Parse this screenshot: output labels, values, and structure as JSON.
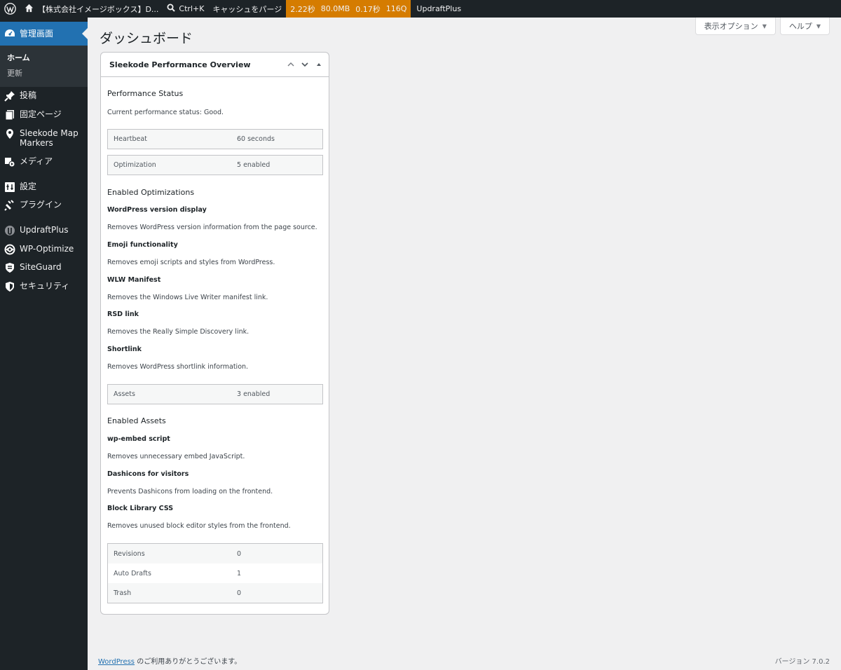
{
  "adminbar": {
    "site_name": "【株式会社イメージボックス】D...",
    "search_shortcut": "Ctrl+K",
    "purge_cache": "キャッシュをパージ",
    "perf": {
      "time": "2.22秒",
      "memory": "80.0MB",
      "query_time": "0.17秒",
      "queries": "116Q"
    },
    "updraft": "UpdraftPlus"
  },
  "sidebar": {
    "dashboard": "管理画面",
    "submenu": [
      "ホーム",
      "更新"
    ],
    "items": [
      {
        "label": "投稿",
        "icon": "pushpin-icon"
      },
      {
        "label": "固定ページ",
        "icon": "pages-icon"
      },
      {
        "label": "Sleekode Map Markers",
        "icon": "location-pin-icon"
      },
      {
        "label": "メディア",
        "icon": "media-icon"
      },
      {
        "label": "設定",
        "icon": "settings-icon"
      },
      {
        "label": "プラグイン",
        "icon": "plugin-icon"
      },
      {
        "label": "UpdraftPlus",
        "icon": "updraftplus-icon"
      },
      {
        "label": "WP-Optimize",
        "icon": "wp-optimize-icon"
      },
      {
        "label": "SiteGuard",
        "icon": "siteguard-icon"
      },
      {
        "label": "セキュリティ",
        "icon": "shield-icon"
      }
    ]
  },
  "header": {
    "title": "ダッシュボード",
    "screen_options": "表示オプション",
    "help": "ヘルプ"
  },
  "widget": {
    "title": "Sleekode Performance Overview",
    "status_heading": "Performance Status",
    "status_text": "Current performance status: Good.",
    "heartbeat": {
      "label": "Heartbeat",
      "value": "60 seconds"
    },
    "optimization": {
      "label": "Optimization",
      "value": "5 enabled"
    },
    "optimizations_heading": "Enabled Optimizations",
    "optimizations": [
      {
        "name": "WordPress version display",
        "desc": "Removes WordPress version information from the page source."
      },
      {
        "name": "Emoji functionality",
        "desc": "Removes emoji scripts and styles from WordPress."
      },
      {
        "name": "WLW Manifest",
        "desc": "Removes the Windows Live Writer manifest link."
      },
      {
        "name": "RSD link",
        "desc": "Removes the Really Simple Discovery link."
      },
      {
        "name": "Shortlink",
        "desc": "Removes WordPress shortlink information."
      }
    ],
    "assets": {
      "label": "Assets",
      "value": "3 enabled"
    },
    "assets_heading": "Enabled Assets",
    "asset_items": [
      {
        "name": "wp-embed script",
        "desc": "Removes unnecessary embed JavaScript."
      },
      {
        "name": "Dashicons for visitors",
        "desc": "Prevents Dashicons from loading on the frontend."
      },
      {
        "name": "Block Library CSS",
        "desc": "Removes unused block editor styles from the frontend."
      }
    ],
    "db": [
      {
        "label": "Revisions",
        "value": "0"
      },
      {
        "label": "Auto Drafts",
        "value": "1"
      },
      {
        "label": "Trash",
        "value": "0"
      }
    ]
  },
  "footer": {
    "link": "WordPress",
    "thanks": " のご利用ありがとうございます。",
    "version": "バージョン 7.0.2"
  }
}
